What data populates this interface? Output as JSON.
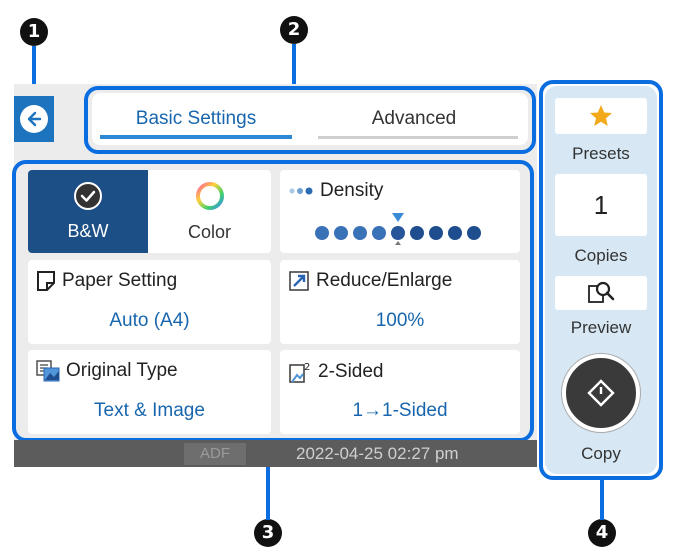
{
  "callouts": [
    "1",
    "2",
    "3",
    "4"
  ],
  "tabs": [
    {
      "label": "Basic Settings",
      "active": true
    },
    {
      "label": "Advanced",
      "active": false
    }
  ],
  "color_mode": {
    "bw_label": "B&W",
    "color_label": "Color",
    "selected": "B&W"
  },
  "density": {
    "label": "Density",
    "level": 5,
    "max": 9
  },
  "settings": [
    {
      "title": "Paper Setting",
      "value": "Auto (A4)"
    },
    {
      "title": "Reduce/Enlarge",
      "value": "100%"
    },
    {
      "title": "Original Type",
      "value": "Text & Image"
    },
    {
      "title": "2-Sided",
      "value": "1→1-Sided"
    }
  ],
  "status": {
    "adf": "ADF",
    "datetime": "2022-04-25 02:27 pm"
  },
  "side": {
    "presets": "Presets",
    "copies_value": "1",
    "copies": "Copies",
    "preview": "Preview",
    "copy": "Copy"
  },
  "colors": {
    "accent": "#0a6de0",
    "selected_tile": "#1c4f86",
    "back_button": "#1c74be",
    "tab_active": "#1866ad",
    "star": "#f2a91a"
  }
}
